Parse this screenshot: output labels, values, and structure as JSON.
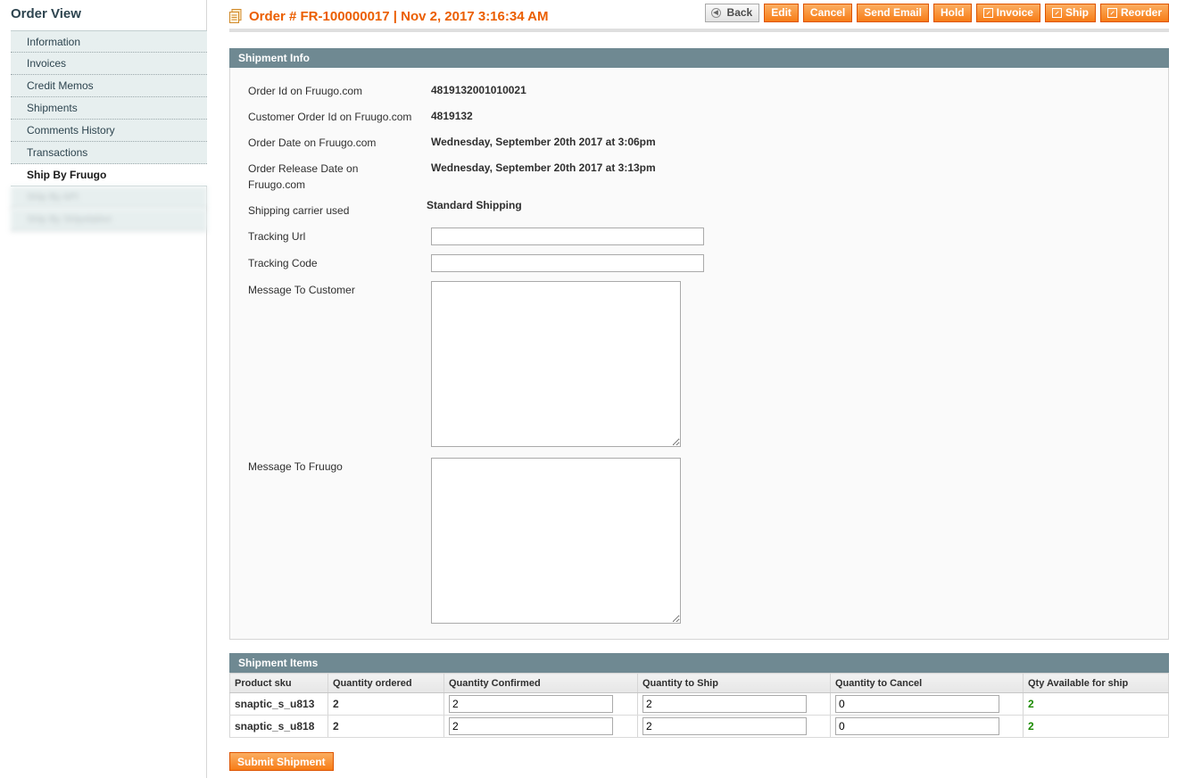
{
  "sidebar": {
    "title": "Order View",
    "items": [
      {
        "label": "Information"
      },
      {
        "label": "Invoices"
      },
      {
        "label": "Credit Memos"
      },
      {
        "label": "Shipments"
      },
      {
        "label": "Comments History"
      },
      {
        "label": "Transactions"
      },
      {
        "label": "Ship By Fruugo"
      },
      {
        "label": "Ship By API"
      },
      {
        "label": "Ship By Shipstation"
      }
    ]
  },
  "header": {
    "title": "Order # FR-100000017 | Nov 2, 2017 3:16:34 AM",
    "buttons": {
      "back": "Back",
      "edit": "Edit",
      "cancel": "Cancel",
      "send_email": "Send Email",
      "hold": "Hold",
      "invoice": "Invoice",
      "ship": "Ship",
      "reorder": "Reorder"
    }
  },
  "shipment_info": {
    "heading": "Shipment Info",
    "order_id_label": "Order Id on Fruugo.com",
    "order_id_value": "4819132001010021",
    "customer_order_id_label": "Customer Order Id on Fruugo.com",
    "customer_order_id_value": "4819132",
    "order_date_label": "Order Date on Fruugo.com",
    "order_date_value": "Wednesday, September 20th 2017 at 3:06pm",
    "release_date_label": "Order Release Date on Fruugo.com",
    "release_date_value": "Wednesday, September 20th 2017 at 3:13pm",
    "carrier_label": "Shipping carrier used",
    "carrier_value": "Standard Shipping",
    "tracking_url_label": "Tracking Url",
    "tracking_url_value": "",
    "tracking_code_label": "Tracking Code",
    "tracking_code_value": "",
    "message_customer_label": "Message To Customer",
    "message_fruugo_label": "Message To Fruugo"
  },
  "shipment_items": {
    "heading": "Shipment Items",
    "columns": [
      "Product sku",
      "Quantity ordered",
      "Quantity Confirmed",
      "Quantity to Ship",
      "Quantity to Cancel",
      "Qty Available for ship"
    ],
    "rows": [
      {
        "sku": "snaptic_s_u813",
        "ordered": "2",
        "confirmed": "2",
        "to_ship": "2",
        "to_cancel": "0",
        "available": "2"
      },
      {
        "sku": "snaptic_s_u818",
        "ordered": "2",
        "confirmed": "2",
        "to_ship": "2",
        "to_cancel": "0",
        "available": "2"
      }
    ]
  },
  "submit_label": "Submit Shipment",
  "colors": {
    "accent": "#eb5e00",
    "button": "#f77c16",
    "section_header": "#6f8992",
    "available_qty": "#1a8a00"
  }
}
